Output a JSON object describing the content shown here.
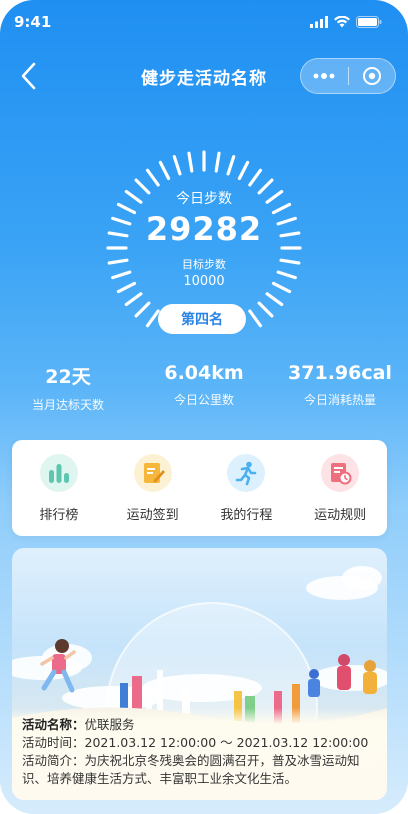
{
  "status_bar": {
    "time": "9:41"
  },
  "nav": {
    "title": "健步走活动名称"
  },
  "ring": {
    "label": "今日步数",
    "steps": "29282",
    "target_label": "目标步数",
    "target": "10000",
    "rank": "第四名"
  },
  "stats": [
    {
      "value": "22天",
      "label": "当月达标天数"
    },
    {
      "value": "6.04km",
      "label": "今日公里数"
    },
    {
      "value": "371.96cal",
      "label": "今日消耗热量"
    }
  ],
  "menu": [
    {
      "label": "排行榜",
      "icon": "ranking-icon",
      "color": "#5ec6b0"
    },
    {
      "label": "运动签到",
      "icon": "checkin-icon",
      "color": "#f5b63c"
    },
    {
      "label": "我的行程",
      "icon": "runner-icon",
      "color": "#4ab0f0"
    },
    {
      "label": "运动规则",
      "icon": "rules-icon",
      "color": "#ee6f7e"
    }
  ],
  "activity": {
    "name_key": "活动名称：",
    "name": "优联服务",
    "time_key": "活动时间：",
    "time": "2021.03.12 12:00:00 ～ 2021.03.12 12:00:00",
    "desc_key": "活动简介：",
    "desc": "为庆祝北京冬残奥会的圆满召开，普及冰雪运动知识、培养健康生活方式、丰富职工业余文化生活。"
  }
}
